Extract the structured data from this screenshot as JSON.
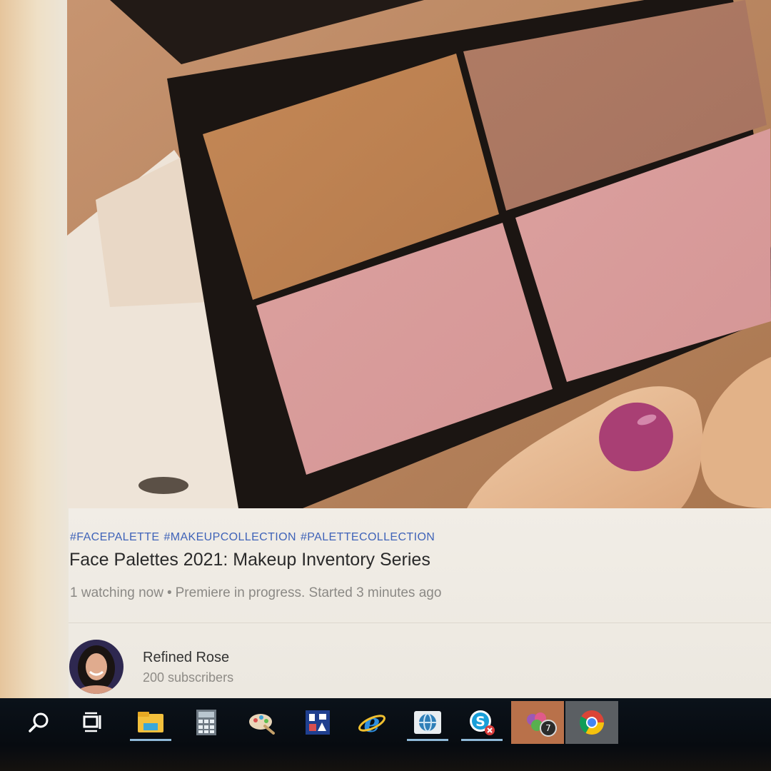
{
  "video": {
    "hashtags": [
      "#FACEPALETTE",
      "#MAKEUPCOLLECTION",
      "#PALETTECOLLECTION"
    ],
    "title": "Face Palettes 2021: Makeup Inventory Series",
    "watching": "1 watching now",
    "separator": "•",
    "status": "Premiere in progress. Started 3 minutes ago"
  },
  "channel": {
    "name": "Refined Rose",
    "subscribers": "200 subscribers"
  },
  "taskbar": {
    "items": [
      {
        "name": "search-icon"
      },
      {
        "name": "task-view-icon"
      },
      {
        "name": "file-explorer-icon"
      },
      {
        "name": "calculator-icon"
      },
      {
        "name": "paint-icon"
      },
      {
        "name": "app-icon"
      },
      {
        "name": "internet-explorer-icon"
      },
      {
        "name": "network-icon"
      },
      {
        "name": "skype-icon"
      },
      {
        "name": "photos-icon",
        "badge": "7"
      },
      {
        "name": "chrome-icon"
      }
    ]
  },
  "colors": {
    "hashtag": "#3f63b8",
    "title": "#2a2a2a",
    "meta": "#8b8985",
    "taskbar": "#0b121a",
    "taskbar_highlight": "#b9714a"
  }
}
